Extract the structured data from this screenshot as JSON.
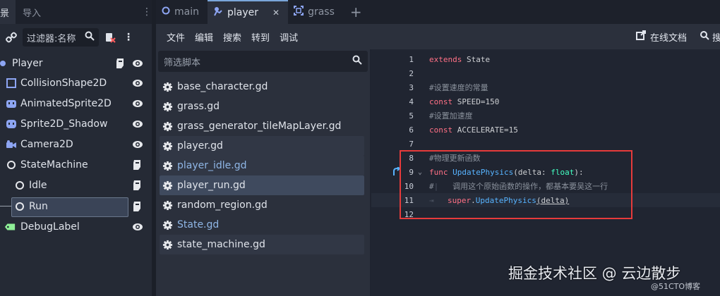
{
  "left_panel": {
    "tabs": [
      {
        "label": "景"
      },
      {
        "label": "导入"
      }
    ],
    "filter_placeholder": "过滤器:名称",
    "nodes": [
      {
        "name": "Player",
        "icon": "node2d-player-icon",
        "has_script": true,
        "visible": true
      },
      {
        "name": "CollisionShape2D",
        "icon": "collision-shape-icon",
        "has_script": false,
        "visible": true
      },
      {
        "name": "AnimatedSprite2D",
        "icon": "animated-sprite-icon",
        "has_script": false,
        "visible": true
      },
      {
        "name": "Sprite2D_Shadow",
        "icon": "sprite-icon",
        "has_script": false,
        "visible": true
      },
      {
        "name": "Camera2D",
        "icon": "camera-icon",
        "has_script": false,
        "visible": true
      },
      {
        "name": "StateMachine",
        "icon": "node-circle-icon",
        "has_script": true,
        "visible": false
      },
      {
        "name": "Idle",
        "icon": "node-circle-icon",
        "has_script": true,
        "visible": false
      },
      {
        "name": "Run",
        "icon": "node-circle-icon",
        "has_script": true,
        "visible": false,
        "selected": true
      },
      {
        "name": "DebugLabel",
        "icon": "label-icon",
        "has_script": false,
        "visible": true
      }
    ]
  },
  "top_tabs": [
    {
      "label": "main",
      "icon": "ring-icon"
    },
    {
      "label": "player",
      "icon": "player-scene-icon",
      "active": true
    },
    {
      "label": "grass",
      "icon": "frame-icon"
    }
  ],
  "menu": {
    "items": [
      "文件",
      "编辑",
      "搜索",
      "转到",
      "调试"
    ],
    "online_docs": "在线文档",
    "search_help": "搜"
  },
  "scripts": {
    "filter_placeholder": "筛选脚本",
    "items": [
      {
        "name": "base_character.gd"
      },
      {
        "name": "grass.gd"
      },
      {
        "name": "grass_generator_tileMapLayer.gd"
      },
      {
        "name": "player.gd"
      },
      {
        "name": "player_idle.gd"
      },
      {
        "name": "player_run.gd"
      },
      {
        "name": "random_region.gd"
      },
      {
        "name": "State.gd"
      },
      {
        "name": "state_machine.gd"
      }
    ]
  },
  "code": {
    "line_numbers": [
      "1",
      "2",
      "3",
      "4",
      "5",
      "6",
      "7",
      "8",
      "9",
      "10",
      "11",
      "12"
    ],
    "l1_kw": "extends",
    "l1_rest": " State",
    "l3": "#设置速度的常量",
    "l4_kw": "const",
    "l4_rest": " SPEED=150",
    "l5": "#设置加速度",
    "l6_kw": "const",
    "l6_rest": " ACCELERATE=15",
    "l8": "#物理更新函数",
    "l9_kw": "func",
    "l9_fn": " UpdatePhysics",
    "l9_a": "(delta: ",
    "l9_type": "float",
    "l9_b": "):",
    "l10_mark": "#",
    "l10": "   调用这个原始函数的操作，都基本要吴这一行",
    "l11_kw": "super",
    "l11_dot": ".",
    "l11_fn": "UpdatePhysics",
    "l11_args": "(delta)"
  },
  "watermark": {
    "main": "掘金技术社区 @ 云边散步",
    "sub": "@51CTO博客"
  },
  "colors": {
    "keyword": "#ff7085",
    "comment": "#8a919c",
    "function": "#57b3ff",
    "type": "#42ffc2",
    "highlight_box": "#e63b3b"
  }
}
